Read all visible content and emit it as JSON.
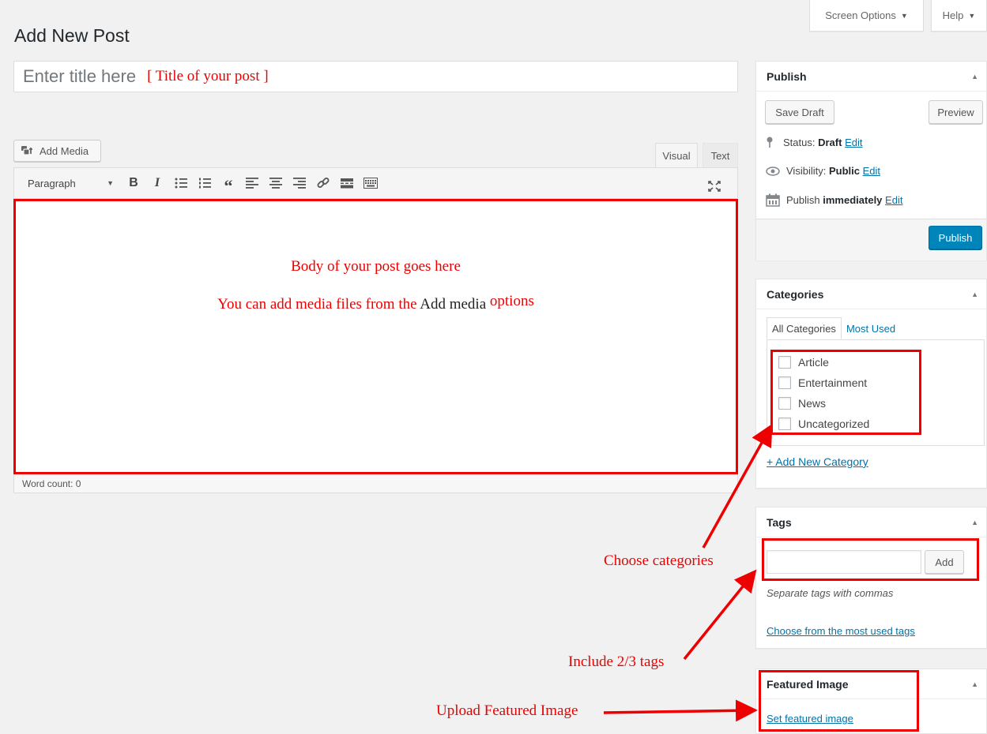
{
  "header": {
    "screen_options": "Screen Options",
    "help": "Help",
    "page_title": "Add New Post"
  },
  "title_field": {
    "placeholder": "Enter title here",
    "annotation": "[ Title of your post ]"
  },
  "editor": {
    "add_media": "Add Media",
    "tab_visual": "Visual",
    "tab_text": "Text",
    "format_select": "Paragraph",
    "toolbar_icons": [
      "bold-icon",
      "italic-icon",
      "bulleted-list-icon",
      "numbered-list-icon",
      "blockquote-icon",
      "align-left-icon",
      "align-center-icon",
      "align-right-icon",
      "link-icon",
      "read-more-icon",
      "toolbar-toggle-icon",
      "fullscreen-icon"
    ],
    "body_line1": "Body of your post goes here",
    "body_line2_a": "You can add media files from the",
    "body_line2_b": "Add media",
    "body_line2_c": "options",
    "word_count": "Word count: 0"
  },
  "publish": {
    "title": "Publish",
    "save_draft": "Save Draft",
    "preview": "Preview",
    "status_label": "Status:",
    "status_value": "Draft",
    "visibility_label": "Visibility:",
    "visibility_value": "Public",
    "schedule_label": "Publish",
    "schedule_value": "immediately",
    "edit": "Edit",
    "publish_button": "Publish"
  },
  "categories": {
    "title": "Categories",
    "tab_all": "All Categories",
    "tab_most_used": "Most Used",
    "items": [
      "Article",
      "Entertainment",
      "News",
      "Uncategorized"
    ],
    "add_new": "+ Add New Category"
  },
  "tags": {
    "title": "Tags",
    "add_button": "Add",
    "hint": "Separate tags with commas",
    "choose_link": "Choose from the most used tags"
  },
  "featured_image": {
    "title": "Featured Image",
    "set_link": "Set featured image"
  },
  "annotations": {
    "choose_categories": "Choose categories",
    "include_tags": "Include 2/3 tags",
    "upload_featured": "Upload Featured Image"
  },
  "colors": {
    "annotation_red": "#e00000",
    "primary_blue": "#0085ba",
    "link_blue": "#0073aa",
    "background": "#f1f1f1"
  }
}
